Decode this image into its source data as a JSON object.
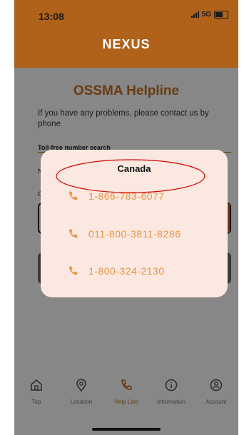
{
  "status_bar": {
    "time": "13:08",
    "network": "5G"
  },
  "header": {
    "title": "NEXUS"
  },
  "page": {
    "title": "OSSMA Helpline",
    "intro": "If you have any problems, please contact us by phone",
    "search_label": "Toll-free number search",
    "field_label_n": "N",
    "field_label_c": "C"
  },
  "modal": {
    "title": "Canada",
    "numbers": [
      "1-866-783-6077",
      "011-800-3811-8286",
      "1-800-324-2130"
    ]
  },
  "nav": {
    "items": [
      {
        "label": "Top",
        "icon": "home-icon"
      },
      {
        "label": "Location",
        "icon": "location-pin-icon"
      },
      {
        "label": "Help Line",
        "icon": "phone-icon",
        "active": true
      },
      {
        "label": "Information",
        "icon": "info-icon"
      },
      {
        "label": "Account",
        "icon": "account-icon"
      }
    ]
  },
  "colors": {
    "brand": "#b0611a",
    "accent": "#c9701f",
    "phone": "#e89246",
    "annotation": "#d40000"
  }
}
